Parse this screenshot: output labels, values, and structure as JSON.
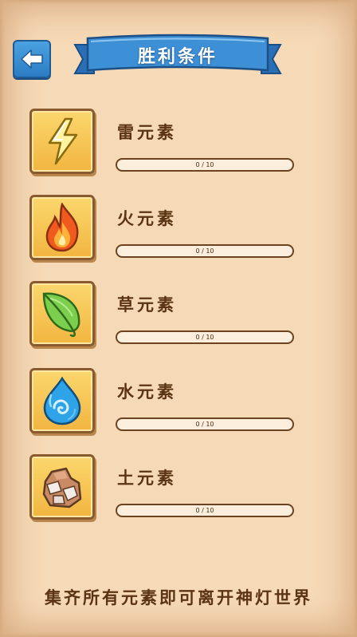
{
  "header": {
    "title": "胜利条件",
    "back_icon": "arrow-left-icon",
    "accent_color": "#2c7cc4"
  },
  "elements": [
    {
      "name": "雷元素",
      "icon": "lightning-icon",
      "current": 0,
      "max": 10,
      "progress_text": "0 / 10"
    },
    {
      "name": "火元素",
      "icon": "fire-icon",
      "current": 0,
      "max": 10,
      "progress_text": "0 / 10"
    },
    {
      "name": "草元素",
      "icon": "leaf-icon",
      "current": 0,
      "max": 10,
      "progress_text": "0 / 10"
    },
    {
      "name": "水元素",
      "icon": "water-drop-icon",
      "current": 0,
      "max": 10,
      "progress_text": "0 / 10"
    },
    {
      "name": "土元素",
      "icon": "rock-icon",
      "current": 0,
      "max": 10,
      "progress_text": "0 / 10"
    }
  ],
  "footer": {
    "text": "集齐所有元素即可离开神灯世界"
  }
}
